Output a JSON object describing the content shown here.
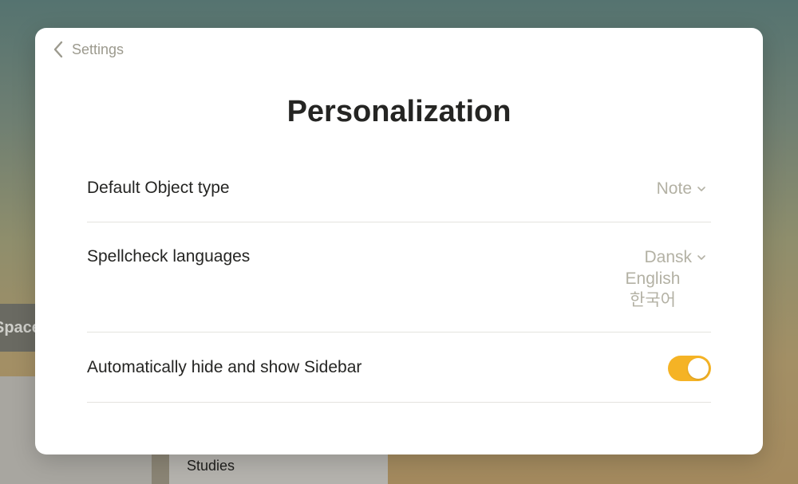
{
  "background": {
    "tab_fragment": "Space",
    "card_text": "Studies"
  },
  "modal": {
    "back_label": "Settings",
    "title": "Personalization",
    "default_object_type": {
      "label": "Default Object type",
      "value": "Note"
    },
    "spellcheck": {
      "label": "Spellcheck languages",
      "languages": [
        "Dansk",
        "English",
        "한국어"
      ]
    },
    "sidebar_toggle": {
      "label": "Automatically hide and show Sidebar",
      "enabled": true
    }
  },
  "colors": {
    "toggle_on": "#f5b325",
    "muted_text": "#b3b1a4",
    "primary_text": "#252523"
  }
}
